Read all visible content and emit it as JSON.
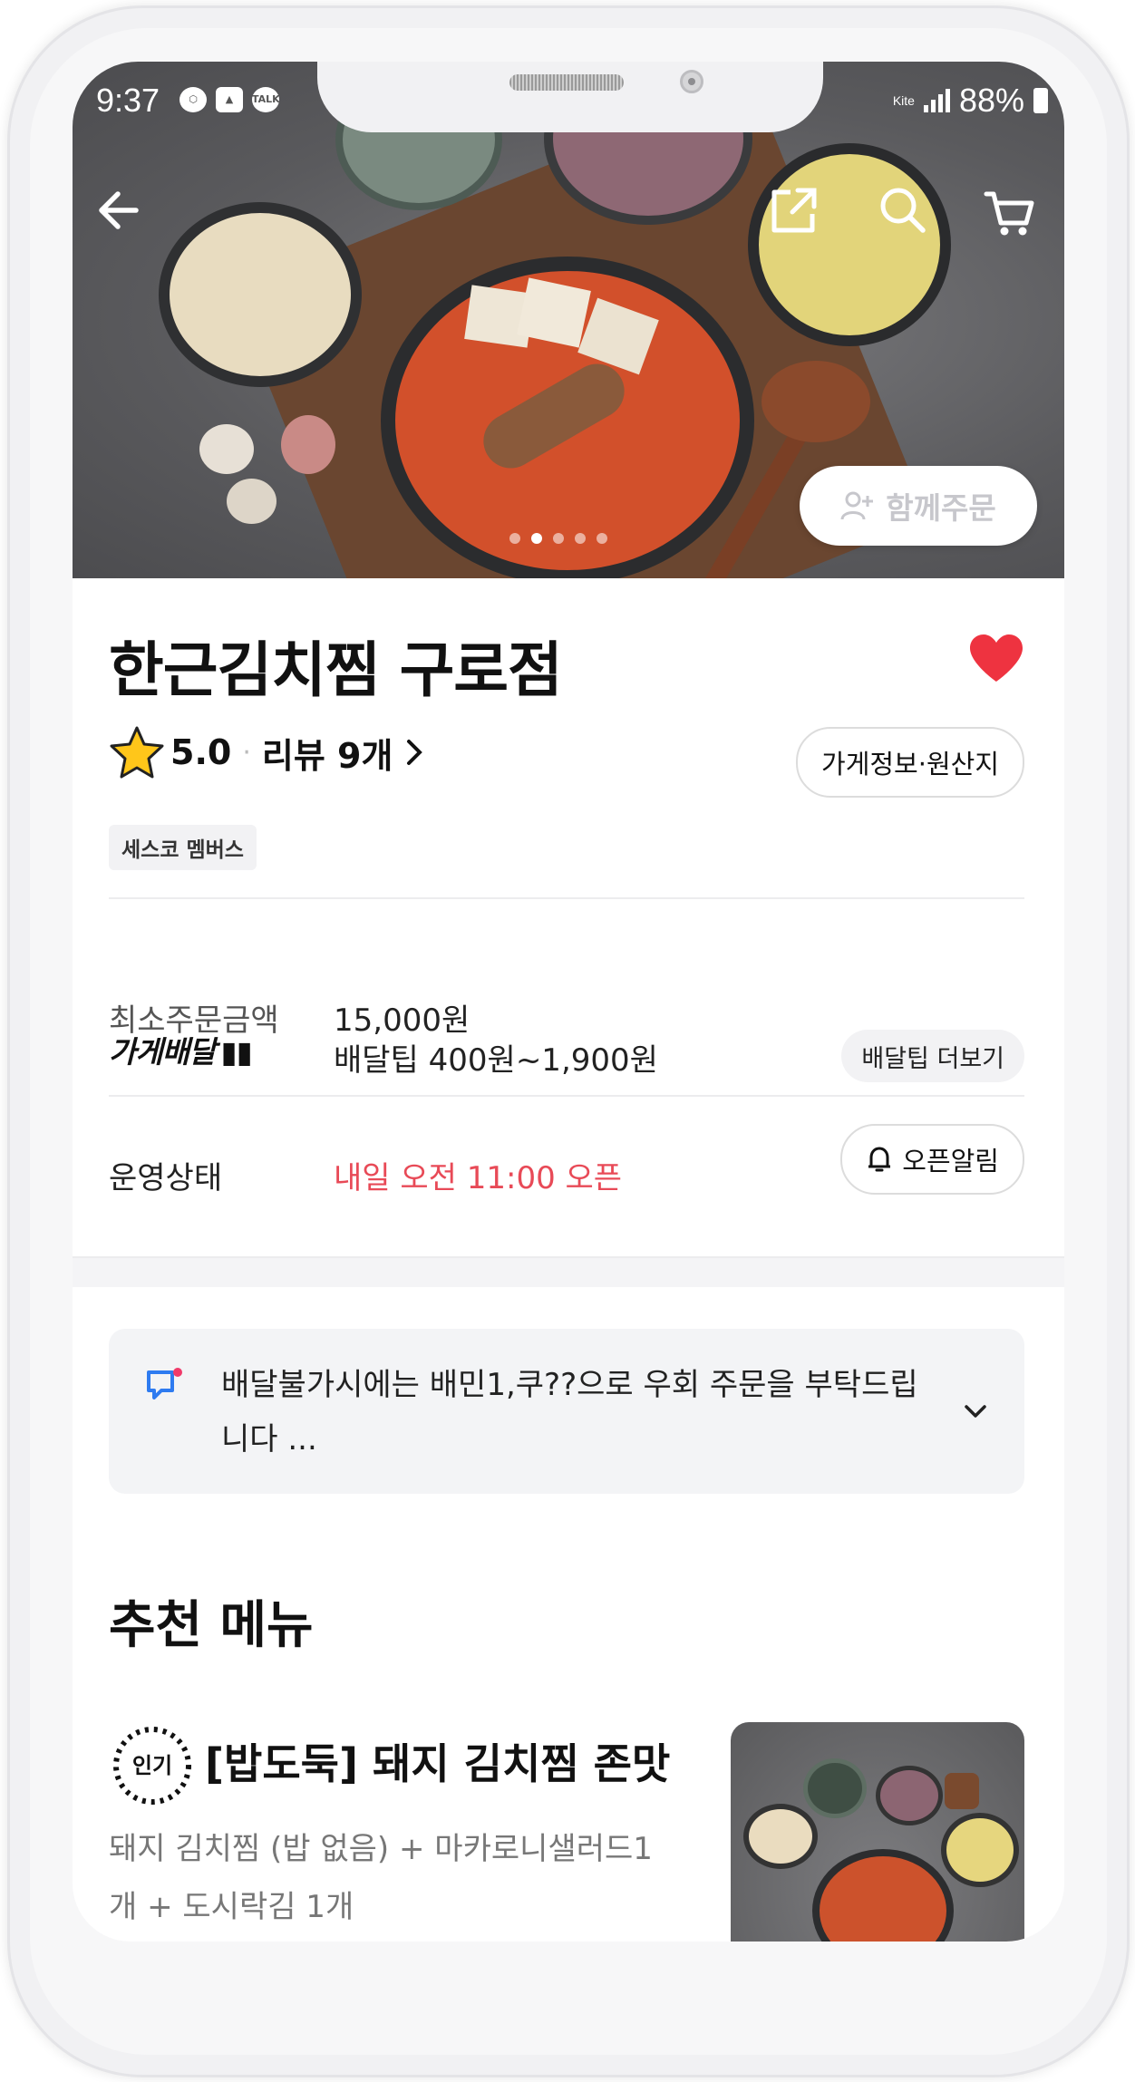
{
  "status_bar": {
    "time": "9:37",
    "icons": [
      "shield-icon",
      "gallery-icon",
      "talk-icon"
    ],
    "talk_badge": "TALK",
    "network_label": "Kite",
    "battery": "88%"
  },
  "header": {
    "together_order_label": "함께주문",
    "carousel_count": 5,
    "carousel_active_index": 1
  },
  "store": {
    "name": "한근김치찜 구로점",
    "favorited": true,
    "rating": "5.0",
    "review_link": "리뷰 9개",
    "info_button": "가게정보·원산지",
    "tag": "세스코 멤버스"
  },
  "order_info": {
    "min_order_label": "최소주문금액",
    "min_order_value": "15,000원",
    "delivery_brand": "가게배달",
    "delivery_tip_value": "배달팁 400원~1,900원",
    "delivery_tip_more": "배달팁 더보기",
    "operation_label": "운영상태",
    "operation_value": "내일 오전 11:00 오픈",
    "open_alarm_button": "오픈알림"
  },
  "notice": {
    "text": "배달불가시에는 배민1,쿠??으로 우회 주문을 부탁드립니다 ..."
  },
  "recommended": {
    "title": "추천 메뉴",
    "items": [
      {
        "badge": "인기",
        "name": "[밥도둑] 돼지 김치찜 존맛",
        "desc": "돼지 김치찜 (밥 없음) + 마카로니샐러드1개 + 도시락김 1개"
      }
    ]
  },
  "colors": {
    "accent_red": "#e84a57",
    "heart": "#ee3340",
    "notice_icon": "#2e7bf0"
  }
}
